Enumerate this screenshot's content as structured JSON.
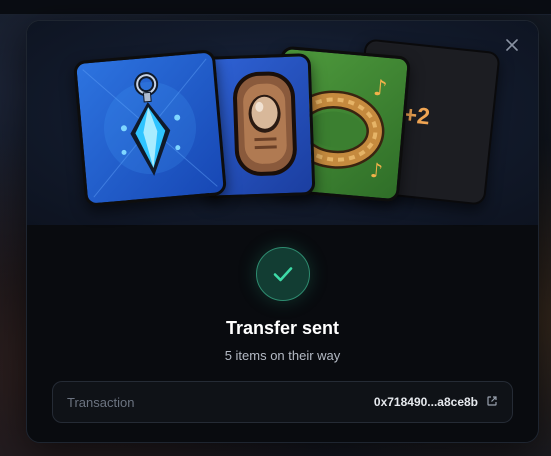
{
  "modal": {
    "cards": {
      "more_label": "+2"
    },
    "title": "Transfer sent",
    "subtitle": "5 items on their way",
    "transaction": {
      "label": "Transaction",
      "hash": "0x718490...a8ce8b"
    },
    "icons": {
      "close": "close-icon",
      "status": "check-icon",
      "external": "external-link-icon"
    },
    "colors": {
      "success": "#3ddba7",
      "more_badge": "#f0a553"
    }
  }
}
